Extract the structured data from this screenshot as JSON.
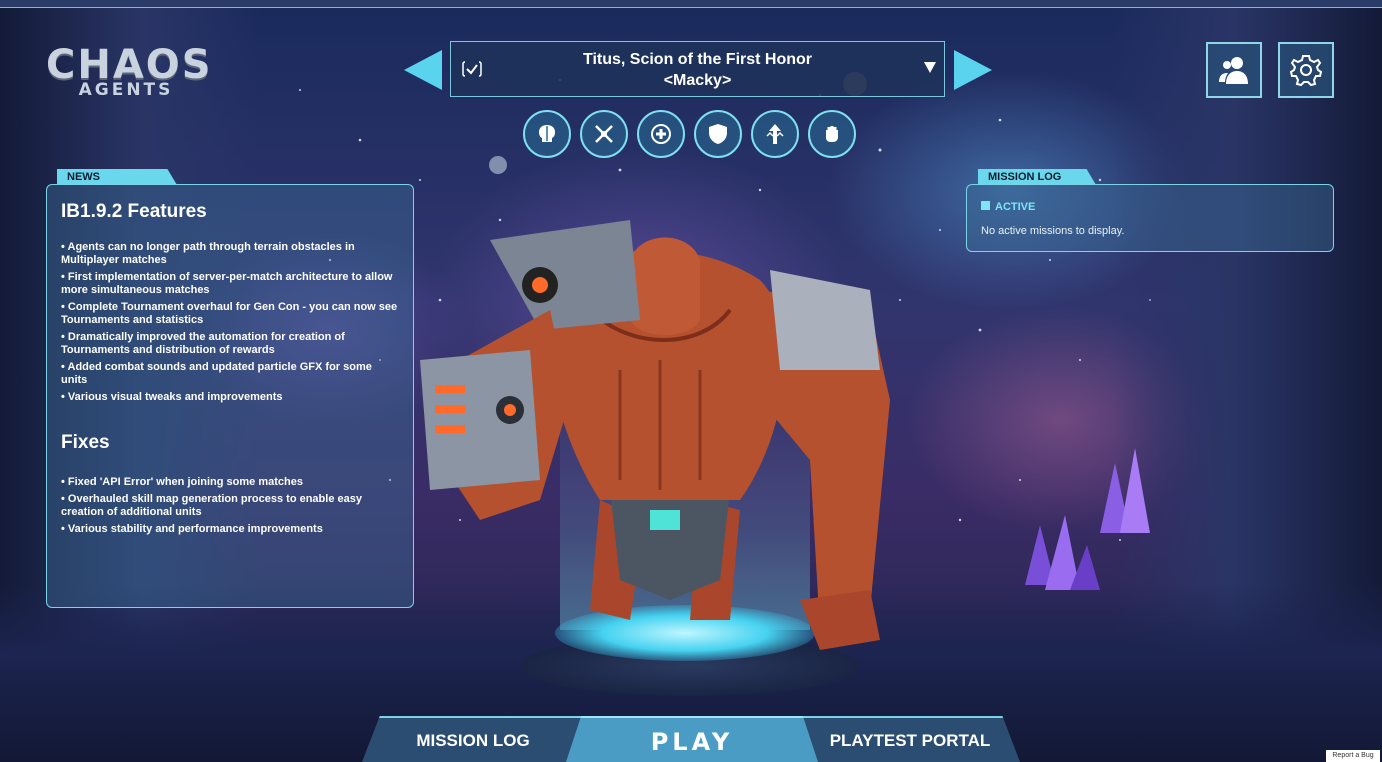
{
  "game": {
    "logo": {
      "main": "CHAOS",
      "sub": "AGENTS"
    }
  },
  "character": {
    "name": "Titus, Scion of the First Honor",
    "player": "<Macky>"
  },
  "skills": [
    {
      "icon": "brain-icon"
    },
    {
      "icon": "crossed-swords-icon"
    },
    {
      "icon": "medic-cross-icon"
    },
    {
      "icon": "shield-icon"
    },
    {
      "icon": "upgrade-arrows-icon"
    },
    {
      "icon": "fist-icon"
    }
  ],
  "top_buttons": [
    {
      "icon": "friends-icon"
    },
    {
      "icon": "gear-icon"
    }
  ],
  "news": {
    "tab_label": "NEWS",
    "heading": "IB1.9.2 Features",
    "features": [
      "• Agents can no longer path through terrain obstacles in Multiplayer matches",
      "• First implementation of server-per-match architecture to allow more simultaneous matches",
      "• Complete Tournament overhaul for Gen Con - you can now see Tournaments and statistics",
      "• Dramatically improved the automation for creation of Tournaments and distribution of rewards",
      "• Added combat sounds and updated particle GFX for some units",
      "• Various visual tweaks and improvements"
    ],
    "fixes_heading": "Fixes",
    "fixes": [
      "• Fixed 'API Error' when joining some matches",
      "• Overhauled skill map generation process to enable easy creation of additional units",
      "• Various stability and performance improvements"
    ]
  },
  "mission_log": {
    "tab_label": "MISSION LOG",
    "status": "ACTIVE",
    "empty_text": "No active missions to display."
  },
  "nav": {
    "mission_log": "MISSION LOG",
    "play": "PLAY",
    "playtest_portal": "PLAYTEST PORTAL"
  },
  "report_bug": "Report a Bug",
  "colors": {
    "accent": "#5ad4ee",
    "panel_border": "#7ad3e6",
    "play_button": "#4a9cc4"
  }
}
